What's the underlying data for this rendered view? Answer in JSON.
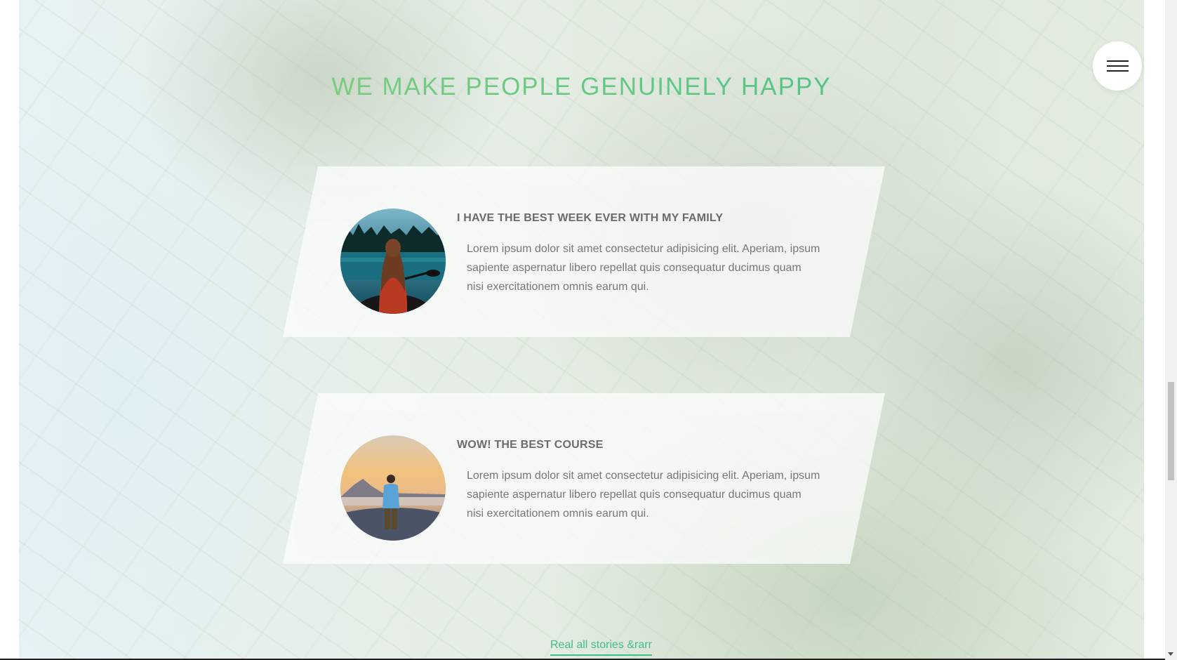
{
  "section": {
    "title": "WE MAKE PEOPLE GENUINELY HAPPY"
  },
  "menu": {
    "icon": "hamburger-menu-icon"
  },
  "testimonials": [
    {
      "title": "I HAVE THE BEST WEEK EVER WITH MY FAMILY",
      "text": "Lorem ipsum dolor sit amet consectetur adipisicing elit. Aperiam, ipsum sapiente aspernatur libero repellat quis consequatur ducimus quam nisi exercitationem omnis earum qui.",
      "photo": "woman-in-canoe-photo"
    },
    {
      "title": "WOW! THE BEST COURSE",
      "text": "Lorem ipsum dolor sit amet consectetur adipisicing elit. Aperiam, ipsum sapiente aspernatur libero repellat quis consequatur ducimus quam nisi exercitationem omnis earum qui.",
      "photo": "man-at-sunset-photo"
    }
  ],
  "footer_link": {
    "label": "Real all stories &rarr"
  },
  "colors": {
    "accent_start": "#8ed27e",
    "accent_end": "#3fbf86",
    "text": "#777777",
    "heading": "#6b6b6b"
  }
}
